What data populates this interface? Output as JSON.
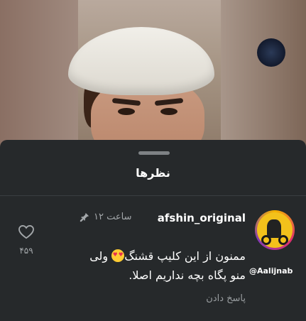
{
  "sheet": {
    "title": "نظرها"
  },
  "comment": {
    "username": "afshin_original",
    "time": "۱۲ ساعت",
    "text_line1": "ممنون از این کلیپ قشنگ",
    "text_line1_end": " ولی",
    "text_line2": "منو پگاه بچه نداریم اصلا.",
    "reply_label": "پاسخ دادن",
    "like_count": "۴۵۹",
    "avatar_handle": "@Aalijnab"
  },
  "icons": {
    "pin": "pin-icon",
    "like": "heart-outline-icon",
    "emoji": "heart-eyes-emoji"
  },
  "colors": {
    "sheet_bg": "#26292b",
    "muted_text": "#a3a7aa"
  }
}
